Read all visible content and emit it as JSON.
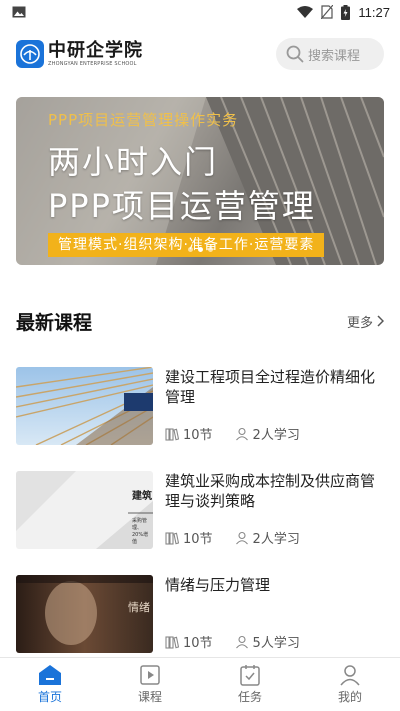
{
  "status_bar": {
    "time": "11:27",
    "icons": [
      "image-icon",
      "wifi-icon",
      "no-sim-icon",
      "battery-charging-icon"
    ]
  },
  "header": {
    "logo_name": "中研企学院",
    "logo_subtitle": "ZHONGYAN ENTERPRISE SCHOOL",
    "search_placeholder": "搜索课程"
  },
  "banner": {
    "eyebrow": "PPP项目运营管理操作实务",
    "title_line1": "两小时入门",
    "title_line2": "PPP项目运营管理",
    "strip": "管理模式·组织架构·准备工作·运营要素",
    "page_count": 3,
    "active_index": 1
  },
  "section": {
    "title": "最新课程",
    "more_label": "更多"
  },
  "courses": [
    {
      "title": "建设工程项目全过程造价精细化管理",
      "sections": "10节",
      "learners": "2人学习"
    },
    {
      "title": "建筑业采购成本控制及供应商管理与谈判策略",
      "sections": "10节",
      "learners": "2人学习",
      "thumb_texts": [
        "建筑",
        "采购管理、",
        "20%增值"
      ]
    },
    {
      "title": "情绪与压力管理",
      "sections": "10节",
      "learners": "5人学习",
      "thumb_texts": [
        "情绪"
      ]
    }
  ],
  "nav": [
    {
      "label": "首页",
      "icon": "home-icon",
      "active": true
    },
    {
      "label": "课程",
      "icon": "course-play-icon",
      "active": false
    },
    {
      "label": "任务",
      "icon": "task-clipboard-icon",
      "active": false
    },
    {
      "label": "我的",
      "icon": "profile-icon",
      "active": false
    }
  ],
  "colors": {
    "accent": "#1a73d9",
    "banner_strip": "#f2b21a",
    "banner_eyebrow": "#f0c04a"
  }
}
